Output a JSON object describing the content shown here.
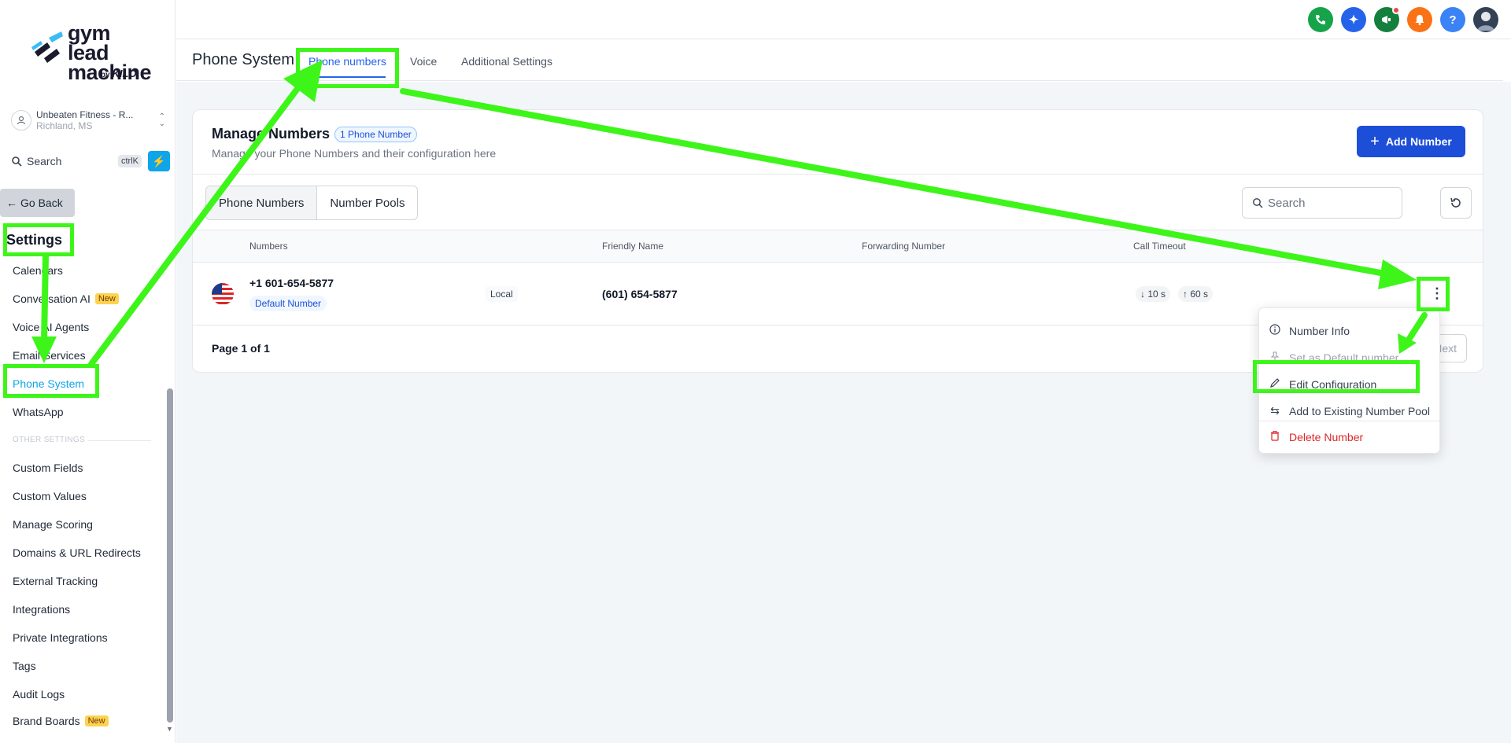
{
  "brand": {
    "logo_line1": "gym lead",
    "logo_line2": "machine",
    "logo_by": "by",
    "logo_kilo": "KILO"
  },
  "location": {
    "name": "Unbeaten Fitness - R...",
    "city": "Richland, MS"
  },
  "sidebar_search": {
    "label": "Search",
    "shortcut": "ctrlK"
  },
  "sidebar": {
    "go_back": "Go Back",
    "settings_title": "Settings",
    "items": [
      {
        "label": "Calendars"
      },
      {
        "label": "Conversation AI",
        "badge": "New"
      },
      {
        "label": "Voice AI Agents"
      },
      {
        "label": "Email Services"
      },
      {
        "label": "Phone System"
      },
      {
        "label": "WhatsApp"
      }
    ],
    "section_label": "OTHER SETTINGS",
    "other_items": [
      {
        "label": "Custom Fields"
      },
      {
        "label": "Custom Values"
      },
      {
        "label": "Manage Scoring"
      },
      {
        "label": "Domains & URL Redirects"
      },
      {
        "label": "External Tracking"
      },
      {
        "label": "Integrations"
      },
      {
        "label": "Private Integrations"
      },
      {
        "label": "Tags"
      },
      {
        "label": "Audit Logs"
      },
      {
        "label": "Brand Boards",
        "badge": "New"
      }
    ]
  },
  "topbar": {
    "help_label": "?",
    "colors": {
      "phone": "#16a34a",
      "ai": "#2563eb",
      "announce": "#15803d",
      "bell": "#f97316",
      "help": "#3b82f6"
    }
  },
  "header": {
    "title": "Phone System",
    "tabs": [
      {
        "label": "Phone numbers"
      },
      {
        "label": "Voice"
      },
      {
        "label": "Additional Settings"
      }
    ]
  },
  "card": {
    "title": "Manage Numbers",
    "count_badge": "1 Phone Number",
    "subtitle": "Manage your Phone Numbers and their configuration here",
    "add_button": "Add Number",
    "segments": [
      "Phone Numbers",
      "Number Pools"
    ],
    "search_placeholder": "Search"
  },
  "table": {
    "headers": [
      "Numbers",
      "Friendly Name",
      "Forwarding Number",
      "Call Timeout"
    ],
    "rows": [
      {
        "number": "+1 601-654-5877",
        "default_badge": "Default Number",
        "type": "Local",
        "friendly_name": "(601) 654-5877",
        "forwarding": "",
        "timeout_in": "10 s",
        "timeout_out": "60 s"
      }
    ],
    "pagination": "Page 1 of 1",
    "next_label": "Next"
  },
  "menu": {
    "items": [
      {
        "label": "Number Info",
        "icon": "info-icon"
      },
      {
        "label": "Set as Default number",
        "icon": "pin-icon",
        "disabled": true
      },
      {
        "label": "Edit Configuration",
        "icon": "pencil-icon"
      },
      {
        "label": "Add to Existing Number Pool",
        "icon": "swap-icon"
      },
      {
        "label": "Delete Number",
        "icon": "trash-icon",
        "danger": true
      }
    ]
  },
  "annotation_color": "#3ef51a"
}
